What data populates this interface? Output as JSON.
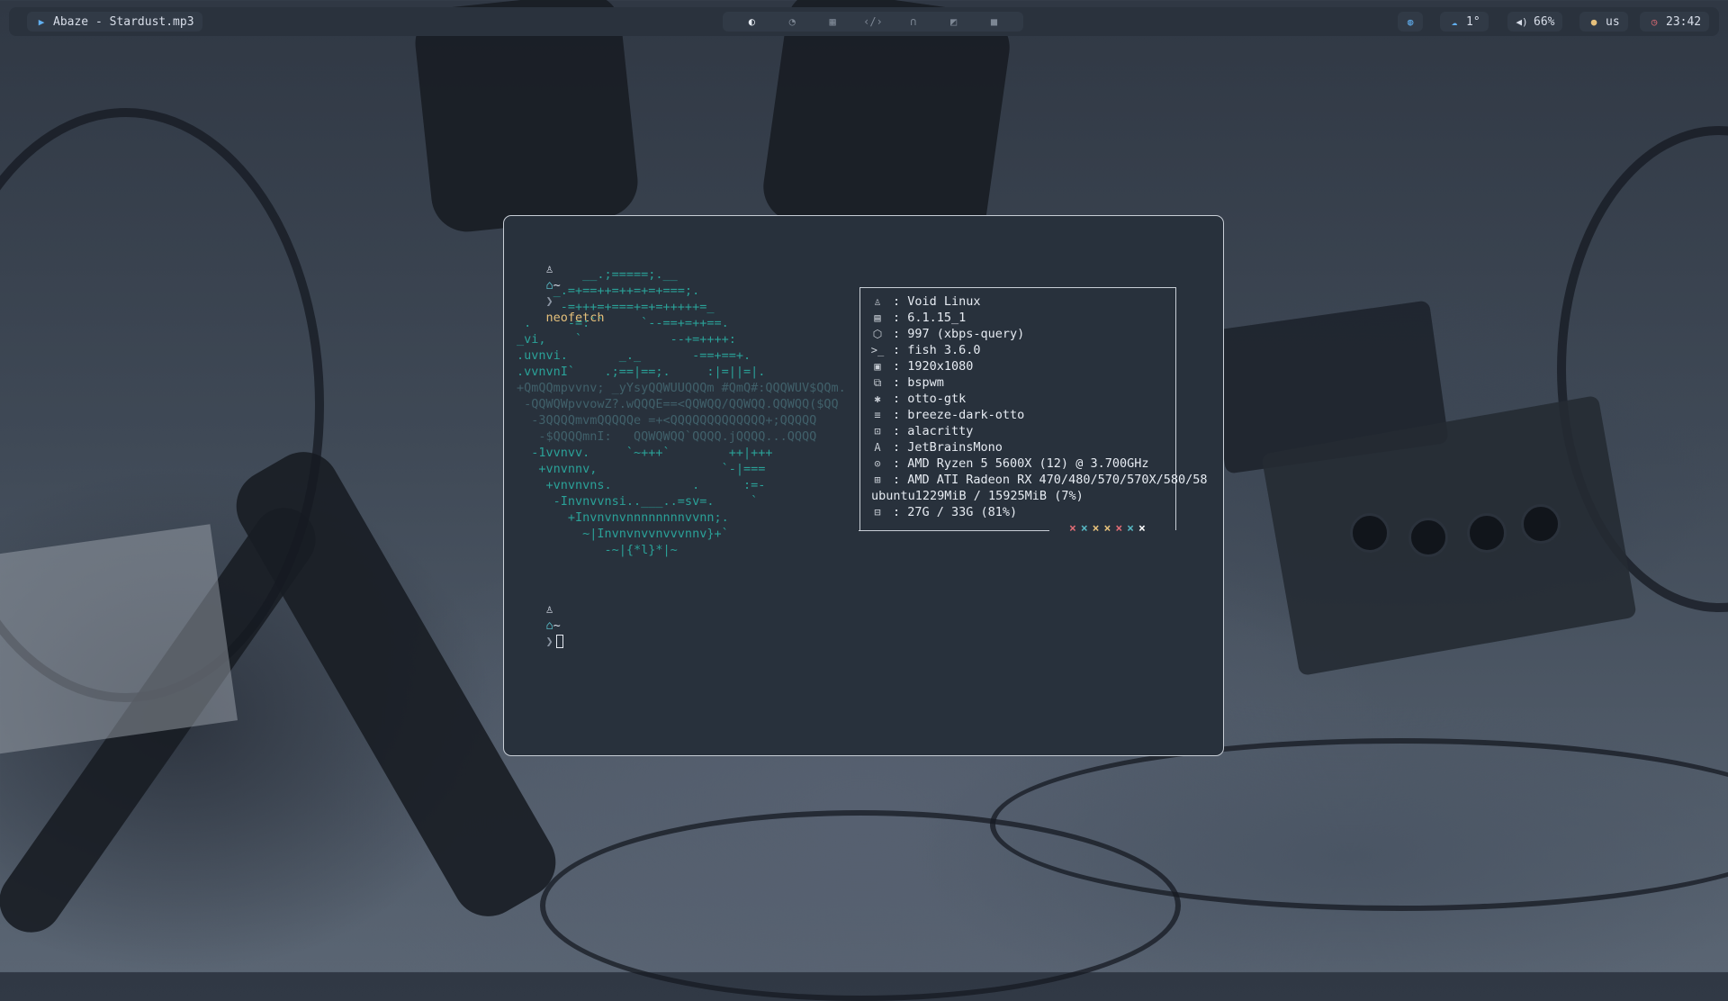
{
  "bar": {
    "media": {
      "icon": "play-circle-icon",
      "title": "Abaze - Stardust.mp3"
    },
    "workspaces": [
      {
        "icon": "moon-icon",
        "active": true
      },
      {
        "icon": "bottle-icon",
        "active": false
      },
      {
        "icon": "calendar-icon",
        "active": false
      },
      {
        "icon": "code-icon",
        "active": false
      },
      {
        "icon": "headphones-icon",
        "active": false
      },
      {
        "icon": "image-icon",
        "active": false
      },
      {
        "icon": "video-icon",
        "active": false
      }
    ],
    "globe_icon": "globe-icon",
    "weather": {
      "icon": "cloud-icon",
      "value": "1°"
    },
    "volume": {
      "icon": "speaker-icon",
      "value": "66%"
    },
    "layout": {
      "icon": "globe-small-icon",
      "value": "us"
    },
    "clock": {
      "icon": "clock-icon",
      "value": "23:42"
    },
    "colors": {
      "bar_bg": "#2a323d",
      "pill_bg": "#313a46",
      "clock": "#e06c75",
      "weather": "#61afef",
      "layout": "#e5c07b"
    }
  },
  "terminal": {
    "prompt": {
      "os_icon": "linux-penguin-icon",
      "home_icon": "home-icon",
      "tilde": "~",
      "arrow": "❯"
    },
    "command": "neofetch",
    "logo_lines": [
      "         __.;=====;.__",
      "     _.=+==++=++=+=+===;.",
      "      -=+++=+===+=+=+++++=_",
      " .     -=:``     `--==+=++==.",
      "_vi,    `            --+=++++:",
      ".uvnvi.       _._       -==+==+.",
      ".vvnvnI`    .;==|==;.     :|=||=|.",
      "+QmQQmpvvnv; _yYsyQQWUUQQQm #QmQ#:QQQWUV$QQm.",
      " -QQWQWpvvowZ?.wQQQE==<QQWQQ/QQWQQ.QQWQQ($QQ",
      "  -3QQQQmvmQQQQQe =+<QQQQQQQQQQQQQ+;QQQQQ",
      "   -$QQQQmnI:   QQWQWQQ`QQQQ.jQQQQ...QQQQ",
      "  -1vvnvv.     `~+++`        ++|+++",
      "   +vnvnnv,                 `-|===",
      "    +vnvnvns.           .      :=-",
      "     -Invnvvnsi..___..=sv=.     `",
      "       +Invnvnvnnnnnnnnvvnn;.",
      "         ~|Invnvnvvnvvvnnv}+`",
      "            -~|{*l}*|~"
    ],
    "info": [
      {
        "icon": "linux-penguin-icon",
        "glyph": "♙",
        "text": ": Void Linux"
      },
      {
        "icon": "kernel-icon",
        "glyph": "▤",
        "text": ": 6.1.15_1"
      },
      {
        "icon": "package-icon",
        "glyph": "⬡",
        "text": ": 997 (xbps-query)"
      },
      {
        "icon": "terminal-prompt-icon",
        "glyph": ">_",
        "text": ": fish 3.6.0"
      },
      {
        "icon": "display-icon",
        "glyph": "▣",
        "text": ": 1920x1080"
      },
      {
        "icon": "window-manager-icon",
        "glyph": "⧉",
        "text": ": bspwm"
      },
      {
        "icon": "palette-icon",
        "glyph": "✱",
        "text": ": otto-gtk"
      },
      {
        "icon": "menu-icon",
        "glyph": "≡",
        "text": ": breeze-dark-otto"
      },
      {
        "icon": "terminal-icon",
        "glyph": "⊡",
        "text": ": alacritty"
      },
      {
        "icon": "font-icon",
        "glyph": "A",
        "text": ": JetBrainsMono"
      },
      {
        "icon": "cpu-icon",
        "glyph": "⊙",
        "text": ": AMD Ryzen 5 5600X (12) @ 3.700GHz"
      },
      {
        "icon": "gpu-icon",
        "glyph": "⊞",
        "text": ": AMD ATI Radeon RX 470/480/570/570X/580/58"
      },
      {
        "icon": "",
        "glyph": "",
        "text": "ubuntu1229MiB / 15925MiB (7%)"
      },
      {
        "icon": "disk-icon",
        "glyph": "⊟",
        "text": ": 27G / 33G (81%)"
      }
    ],
    "color_dots": [
      {
        "char": "×",
        "color": "#e06c75"
      },
      {
        "char": "×",
        "color": "#56b6c2"
      },
      {
        "char": "×",
        "color": "#e5c07b"
      },
      {
        "char": "×",
        "color": "#e5c07b"
      },
      {
        "char": "×",
        "color": "#e06c75"
      },
      {
        "char": "×",
        "color": "#56b6c2"
      },
      {
        "char": "×",
        "color": "#ffffff"
      }
    ]
  }
}
